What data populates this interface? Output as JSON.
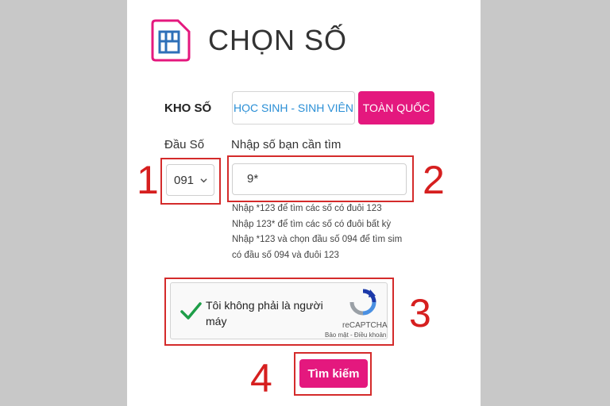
{
  "header": {
    "title": "CHỌN SỐ",
    "icon": "sim-card-icon"
  },
  "kho_so": {
    "label": "KHO SỐ",
    "tabs": [
      {
        "label": "HỌC SINH - SINH VIÊN",
        "active": false
      },
      {
        "label": "TOÀN QUỐC",
        "active": true
      }
    ]
  },
  "form": {
    "prefix_label": "Đầu Số",
    "prefix_value": "091",
    "search_label": "Nhập số bạn cần tìm",
    "search_value": "9*",
    "hints": [
      "Nhập *123 để tìm các số có đuôi 123",
      "Nhập 123* để tìm các số có đuôi bất kỳ",
      "Nhập *123 và chọn đầu số 094 để tìm sim",
      "có đầu số 094 và đuôi 123"
    ]
  },
  "captcha": {
    "text": "Tôi không phải là người máy",
    "brand": "reCAPTCHA",
    "terms": "Bảo mật - Điều khoản"
  },
  "search_button": {
    "label": "Tìm kiếm"
  },
  "annotations": [
    "1",
    "2",
    "3",
    "4"
  ],
  "colors": {
    "accent": "#e4187e",
    "annotation": "#d42b2b",
    "link": "#2a8fd6"
  }
}
